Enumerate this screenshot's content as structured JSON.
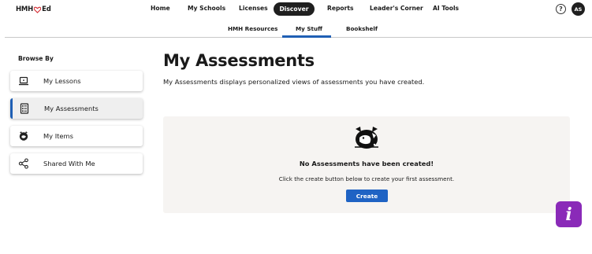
{
  "brand": {
    "name_prefix": "HMH",
    "name_suffix": "Ed",
    "accent_color": "#d6363d"
  },
  "topnav": {
    "items": [
      {
        "label": "Home"
      },
      {
        "label": "My Schools"
      },
      {
        "label": "Licenses"
      },
      {
        "label": "Discover",
        "active": true
      },
      {
        "label": "Reports"
      },
      {
        "label": "Leader's Corner"
      },
      {
        "label": "AI Tools"
      }
    ],
    "help_icon": "?",
    "avatar_initials": "AS"
  },
  "subnav": {
    "items": [
      {
        "label": "HMH Resources"
      },
      {
        "label": "My Stuff",
        "active": true
      },
      {
        "label": "Bookshelf"
      }
    ],
    "active_color": "#1f5fb4"
  },
  "sidebar": {
    "heading": "Browse By",
    "items": [
      {
        "label": "My Lessons",
        "icon": "laptop-icon"
      },
      {
        "label": "My Assessments",
        "icon": "checklist-icon",
        "active": true
      },
      {
        "label": "My Items",
        "icon": "items-icon"
      },
      {
        "label": "Shared With Me",
        "icon": "share-icon"
      }
    ]
  },
  "main": {
    "title": "My Assessments",
    "description": "My Assessments displays personalized views of assessments you have created.",
    "empty_state": {
      "icon": "cat-illustration-icon",
      "title": "No Assessments have been created!",
      "message": "Click the create button below to create your first assessment.",
      "button_label": "Create",
      "button_color": "#1f63c4"
    }
  },
  "info_button": {
    "glyph": "i",
    "color": "#8a2ab8"
  }
}
